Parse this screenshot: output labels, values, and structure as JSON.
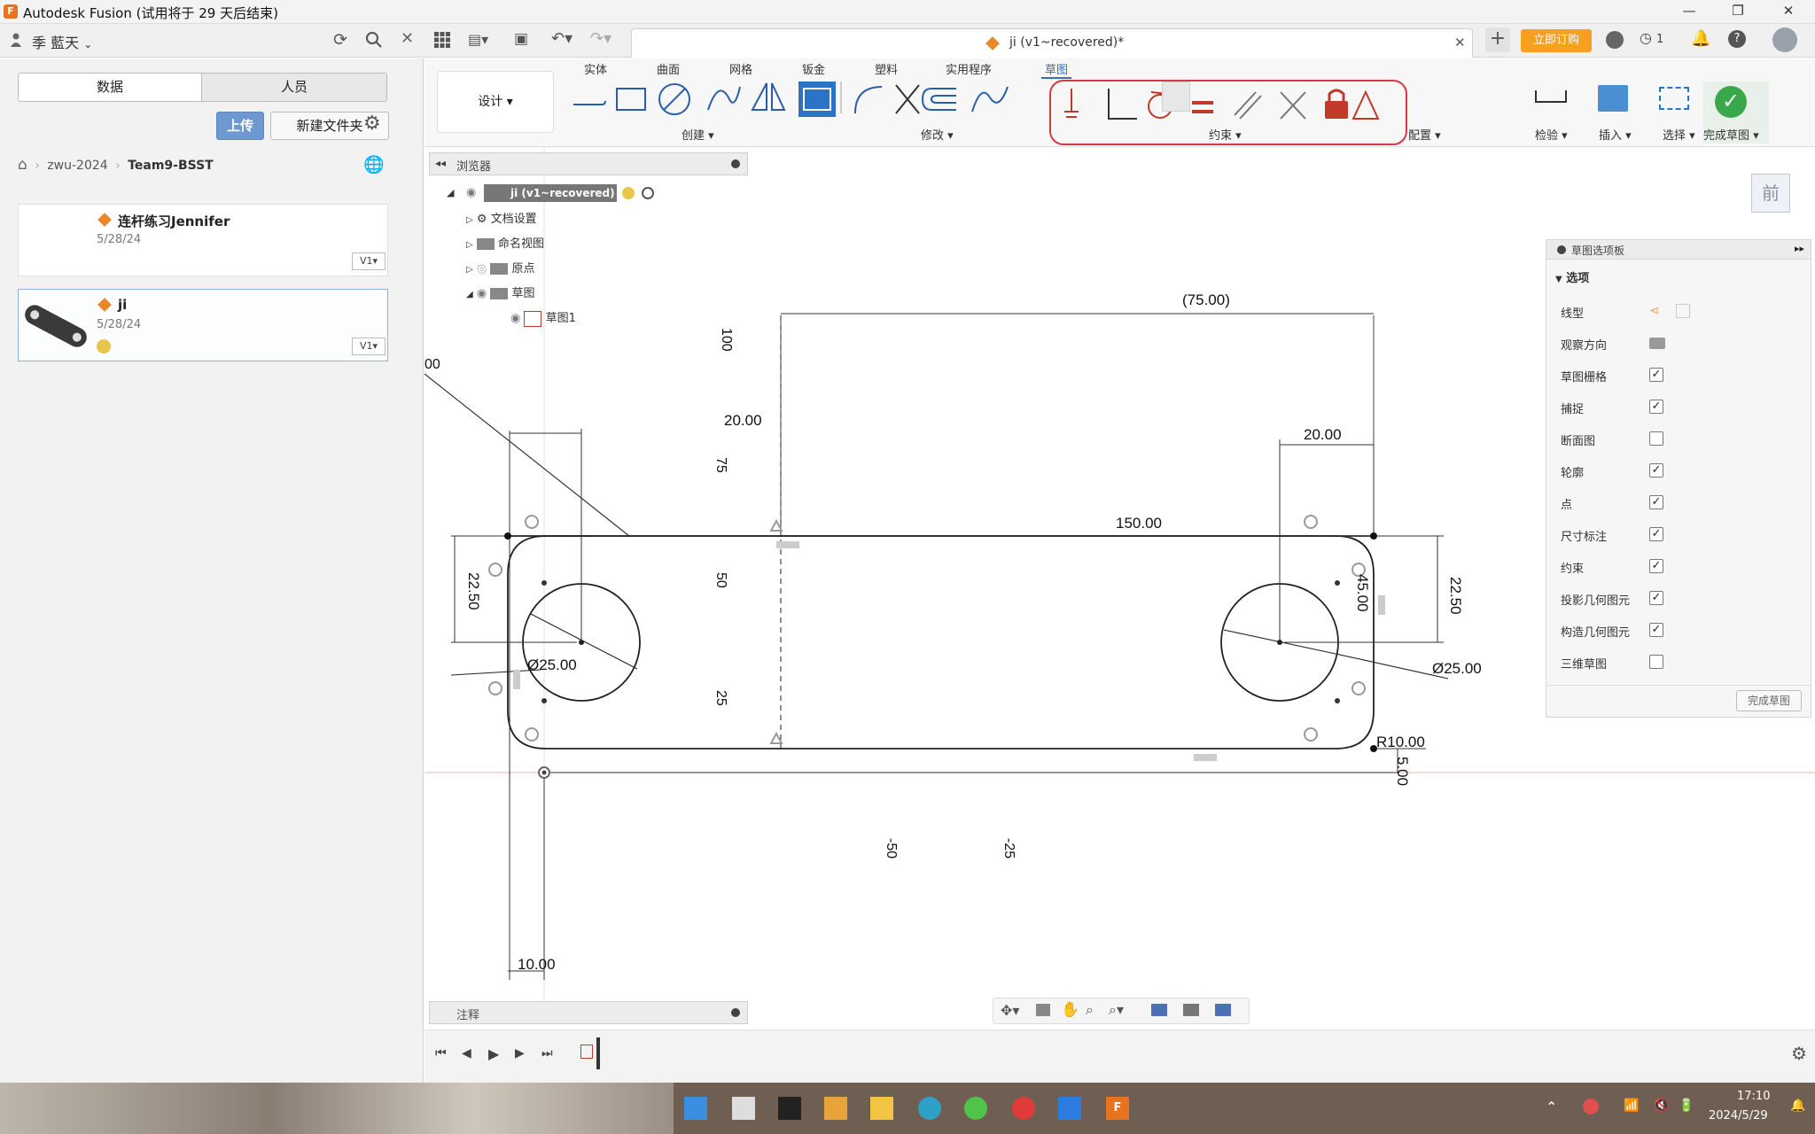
{
  "window": {
    "title": "Autodesk Fusion (试用将于 29 天后结束)",
    "min": "—",
    "max": "❐",
    "close": "✕"
  },
  "appbar": {
    "user": "季 藍天",
    "tab_title": "ji (v1~recovered)*",
    "subscribe": "立即订购",
    "jobs_count": "1"
  },
  "data_panel": {
    "seg_data": "数据",
    "seg_people": "人员",
    "upload": "上传",
    "new_folder": "新建文件夹",
    "breadcrumb": [
      "zwu-2024",
      "Team9-BSST"
    ],
    "items": [
      {
        "name": "连杆练习Jennifer",
        "date": "5/28/24",
        "version": "V1▾"
      },
      {
        "name": "ji",
        "date": "5/28/24",
        "version": "V1▾"
      }
    ]
  },
  "ribbon": {
    "tabs": [
      "实体",
      "曲面",
      "网格",
      "钣金",
      "塑料",
      "实用程序",
      "草图"
    ],
    "active_tab": "草图",
    "design": "设计 ▾",
    "groups": [
      "创建 ▾",
      "修改 ▾",
      "约束 ▾",
      "配置 ▾",
      "检验 ▾",
      "插入 ▾",
      "选择 ▾",
      "完成草图 ▾"
    ]
  },
  "browser": {
    "title": "浏览器",
    "root": "ji (v1~recovered)",
    "nodes": [
      "文档设置",
      "命名视图",
      "原点",
      "草图",
      "草图1"
    ]
  },
  "palette": {
    "title": "草图选项板",
    "section": "选项",
    "rows": [
      {
        "label": "线型",
        "type": "icons"
      },
      {
        "label": "观察方向",
        "type": "icon"
      },
      {
        "label": "草图栅格",
        "checked": true
      },
      {
        "label": "捕捉",
        "checked": true
      },
      {
        "label": "断面图",
        "checked": false
      },
      {
        "label": "轮廓",
        "checked": true
      },
      {
        "label": "点",
        "checked": true
      },
      {
        "label": "尺寸标注",
        "checked": true
      },
      {
        "label": "约束",
        "checked": true
      },
      {
        "label": "投影几何图元",
        "checked": true
      },
      {
        "label": "构造几何图元",
        "checked": true
      },
      {
        "label": "三维草图",
        "checked": false
      }
    ],
    "finish": "完成草图"
  },
  "viewcube": "前",
  "sketch": {
    "dims": {
      "top_dim": "(75.00)",
      "left20": "20.00",
      "right20": "20.00",
      "length": "150.00",
      "h_left": "22.50",
      "h_right": "22.50",
      "dia_left": "Ø25.00",
      "dia_right": "Ø25.00",
      "radius": "R10.00",
      "offset": "5.00",
      "bottom": "10.00",
      "angle": "45.00"
    },
    "ruler": {
      "r100": "100",
      "r75": "75",
      "r50": "50",
      "r25": "25",
      "xm50": "-50",
      "xm25": "-25",
      "r00": "00"
    }
  },
  "notes": "注释",
  "taskbar": {
    "time": "17:10",
    "date": "2024/5/29"
  }
}
